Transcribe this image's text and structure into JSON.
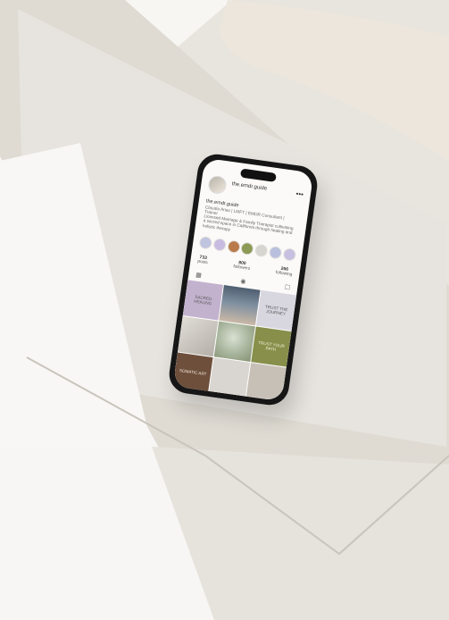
{
  "profile": {
    "handle": "the.emdr.guide",
    "name": "the.emdr.guide",
    "subtitle": "Claudia Arias | LMFT | EMDR Consultant | Trainer",
    "bio": "Licensed Marriage & Family Therapist cultivating a sacred space in California through healing and holistic therapy"
  },
  "stats": [
    {
      "value": "733",
      "label": "posts"
    },
    {
      "value": "800",
      "label": "followers"
    },
    {
      "value": "266",
      "label": "following"
    }
  ],
  "highlights": [
    {
      "color": "#bfc4df"
    },
    {
      "color": "#c8bde0"
    },
    {
      "color": "#b97b4c"
    },
    {
      "color": "#8c9a55"
    },
    {
      "color": "#d7d5cf"
    },
    {
      "color": "#b9c0de"
    },
    {
      "color": "#c8c0e0"
    }
  ],
  "tiles": [
    {
      "label": "SACRED HEALING"
    },
    {
      "label": ""
    },
    {
      "label": "TRUST THE JOURNEY"
    },
    {
      "label": ""
    },
    {
      "label": ""
    },
    {
      "label": "TRUST YOUR PATH"
    },
    {
      "label": "SOMATIC ART"
    },
    {
      "label": ""
    },
    {
      "label": ""
    }
  ]
}
